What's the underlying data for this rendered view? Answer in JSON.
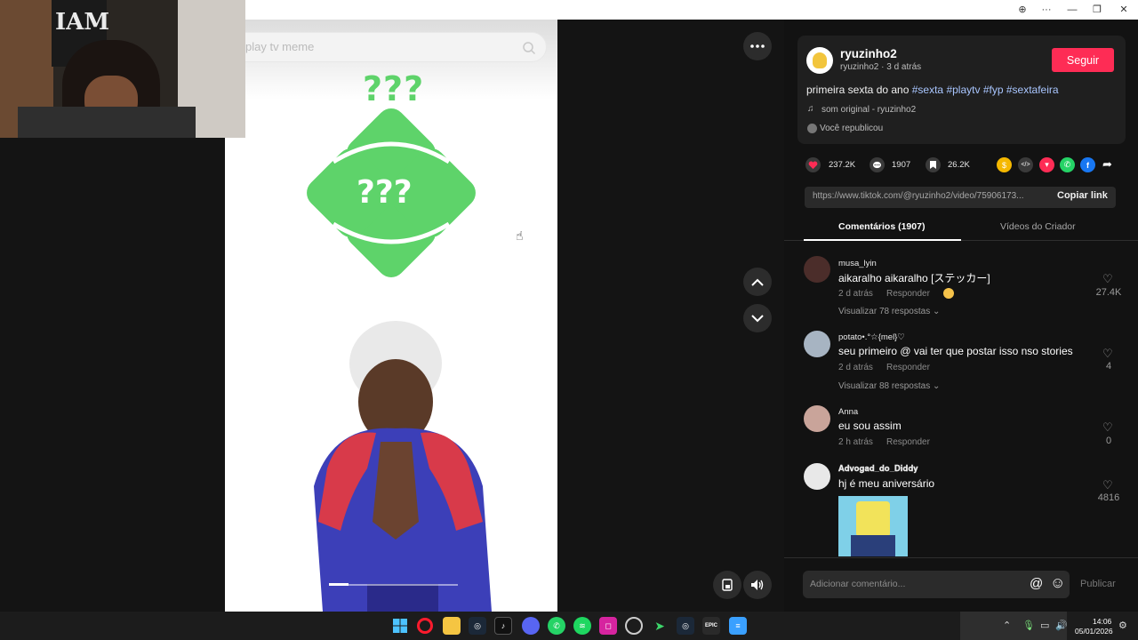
{
  "window": {
    "zoom_label": "⊕",
    "more_label": "···",
    "minimize_label": "—",
    "restore_label": "❐",
    "close_label": "✕"
  },
  "search": {
    "placeholder": "play tv meme"
  },
  "video": {
    "question_top": "???",
    "question_center": "???"
  },
  "webcam": {
    "shirt_text": "IAM"
  },
  "post": {
    "username": "ryuzinho2",
    "handle_time": "ryuzinho2 · 3 d atrás",
    "follow_label": "Seguir",
    "caption_plain": "primeira sexta do ano",
    "hashtags": [
      "#sexta",
      "#playtv",
      "#fyp",
      "#sextafeira"
    ],
    "music": "som original - ryuzinho2",
    "reposted": "Você republicou",
    "likes": "237.2K",
    "comments": "1907",
    "saves": "26.2K",
    "link": "https://www.tiktok.com/@ryuzinho2/video/75906173...",
    "copy_label": "Copiar link"
  },
  "tabs": [
    "Comentários (1907)",
    "Vídeos do Criador"
  ],
  "comments": [
    {
      "user": "musa_lyin",
      "text": "aikaralho aikaralho [ステッカー]",
      "time": "2 d atrás",
      "reply": "Responder",
      "more": "Visualizar 78 respostas",
      "likes": "27.4K"
    },
    {
      "user": "potato•.°☆{mel}♡",
      "text": "seu primeiro @ vai ter que postar isso nso stories",
      "time": "2 d atrás",
      "reply": "Responder",
      "more": "Visualizar 88 respostas",
      "likes": "4"
    },
    {
      "user": "Anna",
      "text": "eu sou assim",
      "time": "2 h atrás",
      "reply": "Responder",
      "more": "",
      "likes": "0"
    },
    {
      "user": "𝐀𝐝𝐯𝐨𝐠𝐚𝐝_𝐝𝐨_𝐃𝐢𝐝𝐝𝐲",
      "text": "hj é meu aniversário",
      "time": "",
      "reply": "",
      "more": "",
      "likes": "4816"
    }
  ],
  "comment_input": {
    "placeholder": "Adicionar comentário...",
    "at_label": "@",
    "emoji_label": "☺",
    "publish_label": "Publicar"
  },
  "taskbar": {
    "time": "14:06",
    "date": "05/01/2026",
    "epic_label": "EPIC"
  },
  "colors": {
    "accent": "#fe2c55",
    "green": "#5ed36a",
    "hashtag": "#a9c6ff"
  }
}
